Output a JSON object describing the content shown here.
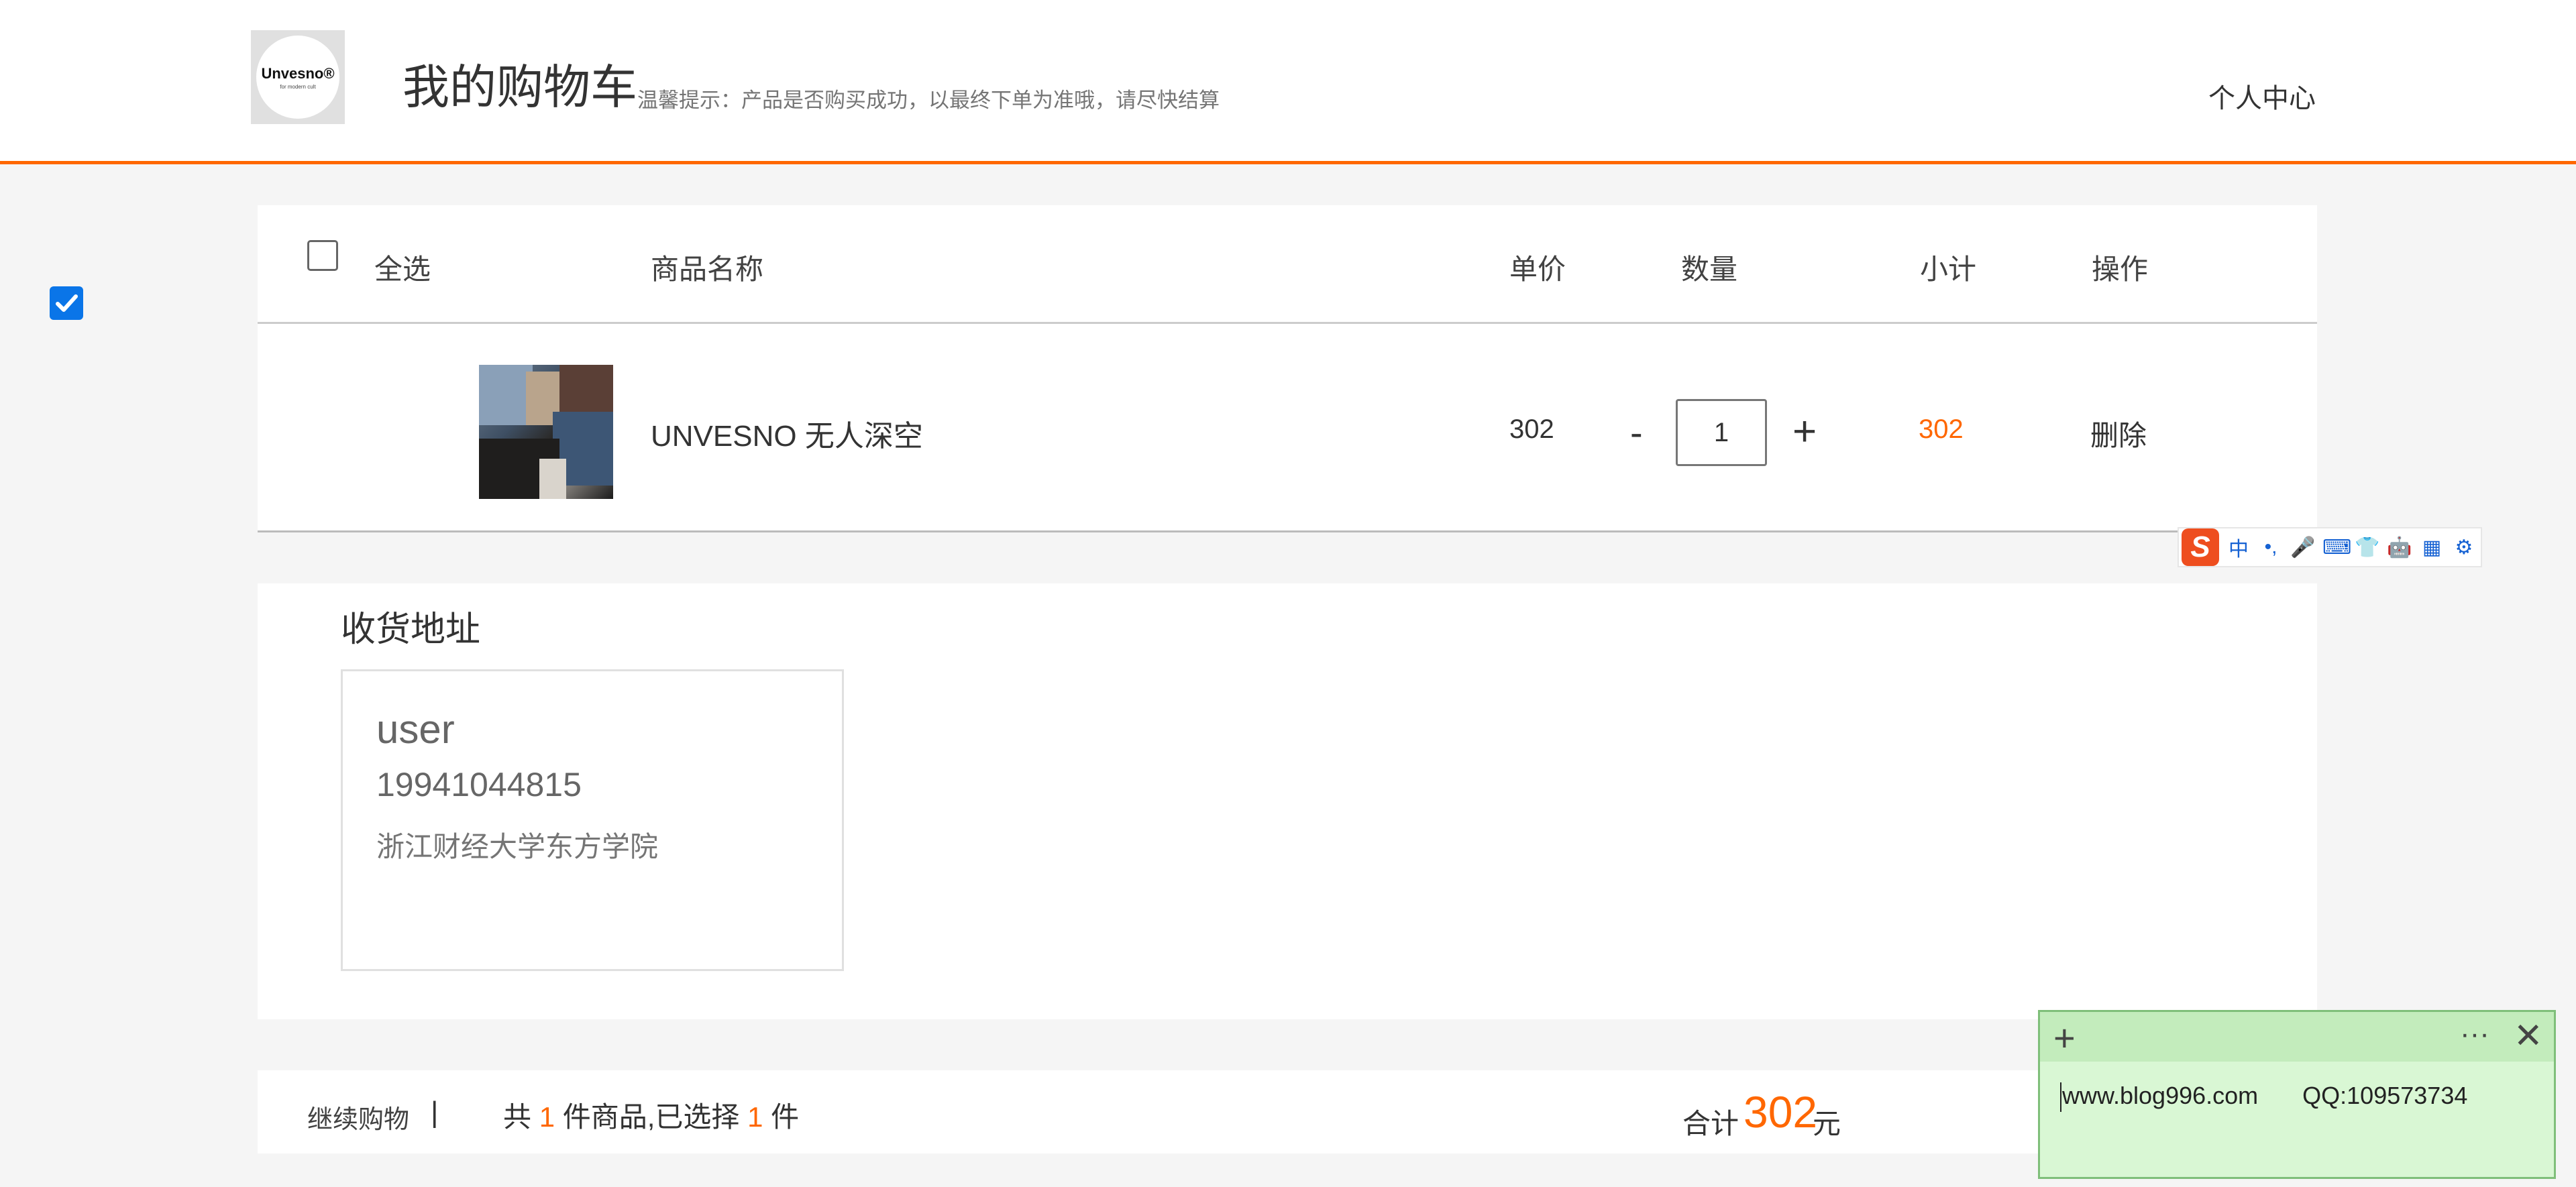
{
  "header": {
    "logo_text": "Unvesno®",
    "logo_sub": "for modern cult",
    "title": "我的购物车",
    "tip": "温馨提示：产品是否购买成功，以最终下单为准哦，请尽快结算",
    "user_center": "个人中心"
  },
  "cart": {
    "columns": {
      "select_all": "全选",
      "name": "商品名称",
      "price": "单价",
      "quantity": "数量",
      "subtotal": "小计",
      "action": "操作"
    },
    "items": [
      {
        "checked": true,
        "name": "UNVESNO 无人深空",
        "price": "302",
        "minus": "-",
        "quantity": "1",
        "plus": "+",
        "subtotal": "302",
        "action": "删除"
      }
    ]
  },
  "ime": {
    "logo": "S",
    "icons": [
      "中",
      "•,",
      "🎤",
      "⌨",
      "👕",
      "🤖",
      "▦",
      "⚙"
    ],
    "icon_names": [
      "chinese-mode-icon",
      "punctuation-icon",
      "microphone-icon",
      "keyboard-icon",
      "skin-icon",
      "robot-icon",
      "toolbox-icon",
      "settings-icon"
    ]
  },
  "address": {
    "title": "收货地址",
    "name": "user",
    "phone": "19941044815",
    "place": "浙江财经大学东方学院"
  },
  "footer": {
    "continue": "继续购物",
    "separator": "|",
    "count_prefix": "共",
    "count_total": "1",
    "count_middle": "件商品,已选择",
    "count_selected": "1",
    "count_suffix": "件",
    "total_label": "合计",
    "total_value": "302",
    "total_unit": "元"
  },
  "note": {
    "plus": "+",
    "more": "···",
    "close": "✕",
    "site": "www.blog996.com",
    "qq": "QQ:109573734"
  },
  "colors": {
    "accent": "#ff6700",
    "checkbox": "#0a75e8",
    "note_bg": "#d9f7d4"
  }
}
